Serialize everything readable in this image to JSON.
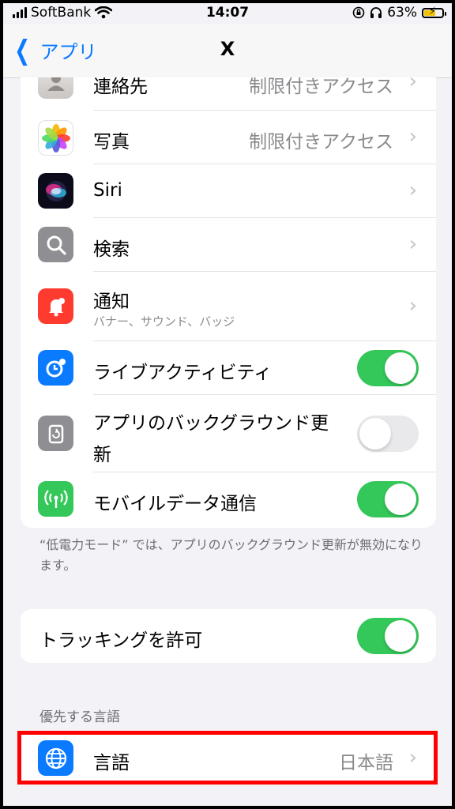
{
  "status_bar": {
    "carrier": "SoftBank",
    "time": "14:07",
    "battery": "63%",
    "battery_level": 0.63
  },
  "nav": {
    "back_label": "アプリ",
    "title": "X"
  },
  "permissions": [
    {
      "id": "contacts",
      "label": "連絡先",
      "value": "制限付きアクセス",
      "icon": "contacts-icon"
    },
    {
      "id": "photos",
      "label": "写真",
      "value": "制限付きアクセス",
      "icon": "photos-icon"
    },
    {
      "id": "siri",
      "label": "Siri",
      "icon": "siri-icon"
    },
    {
      "id": "search",
      "label": "検索",
      "icon": "search-icon"
    },
    {
      "id": "notifications",
      "label": "通知",
      "sublabel": "バナー、サウンド、バッジ",
      "icon": "notification-bell-icon"
    },
    {
      "id": "live-activities",
      "label": "ライブアクティビティ",
      "toggle": true,
      "icon": "live-activities-icon"
    },
    {
      "id": "background-refresh",
      "label": "アプリのバックグラウンド更新",
      "toggle": false,
      "icon": "background-refresh-icon"
    },
    {
      "id": "mobile-data",
      "label": "モバイルデータ通信",
      "toggle": true,
      "icon": "antenna-icon"
    }
  ],
  "low_power_note": "“低電力モード” では、アプリのバックグラウンド更新が無効になります。",
  "tracking": {
    "label": "トラッキングを許可",
    "toggle": true
  },
  "language_section": {
    "header": "優先する言語",
    "label": "言語",
    "value": "日本語",
    "icon": "globe-icon"
  },
  "colors": {
    "accent": "#0a7aff",
    "toggle_on": "#34c759",
    "highlight": "#ff0000"
  }
}
